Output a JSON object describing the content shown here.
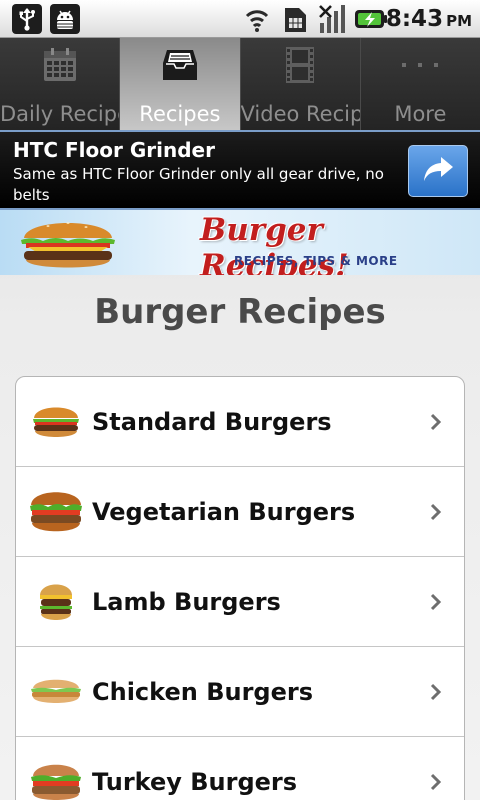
{
  "status_bar": {
    "time": "8:43",
    "ampm": "PM",
    "icons": [
      "usb-icon",
      "android-debug-icon",
      "wifi-icon",
      "sim-icon",
      "no-signal-icon",
      "battery-charging-icon"
    ]
  },
  "tabs": [
    {
      "label": "Daily Recipes",
      "icon": "calendar-icon",
      "active": false
    },
    {
      "label": "Recipes",
      "icon": "inbox-icon",
      "active": true
    },
    {
      "label": "Video Recipe",
      "icon": "film-icon",
      "active": false
    },
    {
      "label": "More",
      "icon": "more-dots-icon",
      "active": false
    }
  ],
  "ad": {
    "title": "HTC Floor Grinder",
    "body": "Same as HTC Floor Grinder only all gear drive, no belts",
    "button_icon": "share-arrow-icon",
    "border_color": "#7a9dc8",
    "button_color": "#3a86dc"
  },
  "banner": {
    "title": "Burger Recipes!",
    "tagline": "RECIPES, TIPS & MORE",
    "title_color": "#c21e1e",
    "tagline_color": "#2a3f88"
  },
  "page": {
    "title": "Burger Recipes"
  },
  "recipes": [
    {
      "label": "Standard Burgers",
      "icon": "burger-thumbnail-icon"
    },
    {
      "label": "Vegetarian Burgers",
      "icon": "burger-thumbnail-icon"
    },
    {
      "label": "Lamb Burgers",
      "icon": "burger-thumbnail-icon"
    },
    {
      "label": "Chicken Burgers",
      "icon": "burger-thumbnail-icon"
    },
    {
      "label": "Turkey Burgers",
      "icon": "burger-thumbnail-icon"
    }
  ],
  "colors": {
    "active_tab_label": "#ffffff",
    "inactive_tab_label": "#8e8e8e",
    "page_title": "#4a4a4a",
    "list_text": "#111111"
  }
}
